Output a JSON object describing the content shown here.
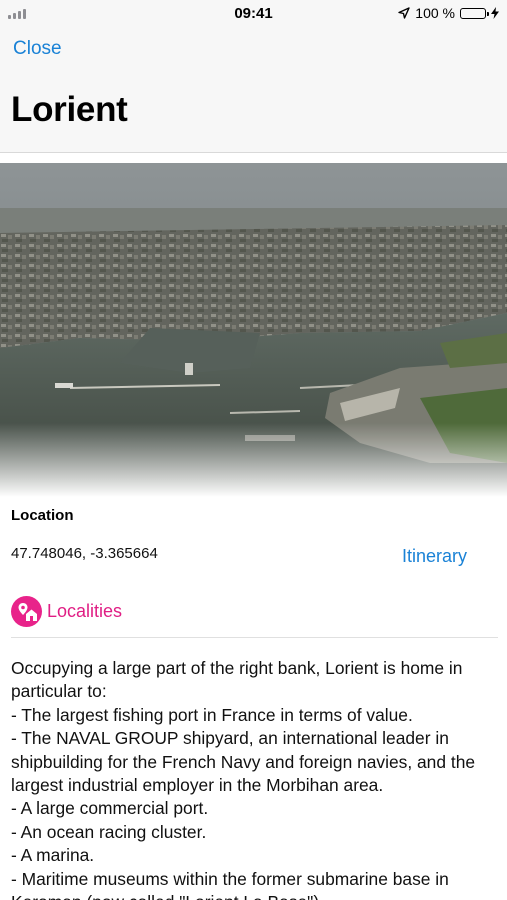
{
  "status_bar": {
    "time": "09:41",
    "battery_text": "100 %"
  },
  "header": {
    "close_label": "Close",
    "title": "Lorient"
  },
  "hero_image": {
    "icon": "aerial-photo-harbour"
  },
  "location": {
    "label": "Location",
    "coordinates": "47.748046, -3.365664",
    "itinerary_label": "Itinerary"
  },
  "category": {
    "label": "Localities",
    "icon": "localities-icon",
    "color": "#e8238a"
  },
  "description": "Occupying a large part of the right bank, Lorient is home in particular to:\n- The largest fishing port in France in terms of value.\n- The NAVAL GROUP shipyard, an international leader in shipbuilding for the French Navy and foreign navies, and the largest industrial employer in the Morbihan area.\n- A large commercial port.\n- An ocean racing cluster.\n- A marina.\n- Maritime museums within the former submarine base in Keroman (now called \"Lorient La Base\").",
  "colors": {
    "accent_blue": "#1a82d6",
    "category_pink": "#e8238a",
    "battery_green": "#4cd964"
  }
}
